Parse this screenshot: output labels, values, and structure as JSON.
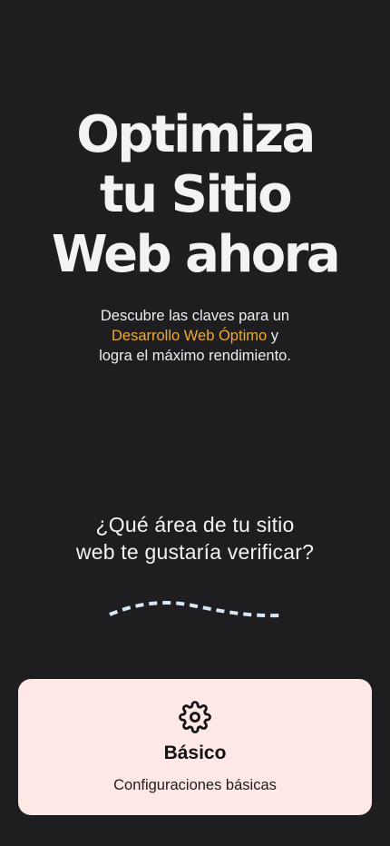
{
  "hero": {
    "title_lines": [
      "Optimiza",
      "tu Sitio",
      "Web ahora"
    ]
  },
  "intro": {
    "line1": "Descubre las claves para un",
    "highlight": "Desarrollo Web Óptimo",
    "after_highlight": " y",
    "line3": "logra el máximo rendimiento."
  },
  "question": {
    "line1": "¿Qué área de tu sitio",
    "line2": "web te gustaría verificar?"
  },
  "option_card": {
    "icon": "gear-icon",
    "title": "Básico",
    "description": "Configuraciones básicas"
  },
  "colors": {
    "background": "#1e1e20",
    "highlight": "#f0a830",
    "card_background": "#fde8e6",
    "squiggle": "#d9e6f5"
  }
}
